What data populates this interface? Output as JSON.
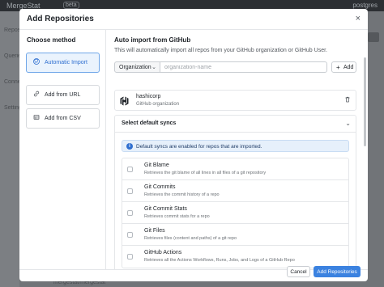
{
  "backdrop": {
    "logo": "MergeStat",
    "beta": "beta",
    "user": "postgres",
    "sidebar": [
      "Repos",
      "Queries",
      "Connect",
      "Settings"
    ],
    "bottom_text": "mergestat/mergestat"
  },
  "modal": {
    "title": "Add Repositories",
    "close": "×"
  },
  "methods": {
    "heading": "Choose method",
    "items": [
      {
        "label": "Automatic Import",
        "icon": "github-icon"
      },
      {
        "label": "Add from URL",
        "icon": "link-icon"
      },
      {
        "label": "Add from CSV",
        "icon": "table-icon"
      }
    ]
  },
  "auto_import": {
    "title": "Auto import from GitHub",
    "description": "This will automatically import all repos from your GitHub organization or GitHub User.",
    "select_value": "Organization",
    "input_placeholder": "organization-name",
    "add_label": "Add"
  },
  "org": {
    "name": "hashicorp",
    "type": "GitHub organization"
  },
  "syncs": {
    "title": "Select default syncs",
    "info": "Default syncs are enabled for repos that are imported.",
    "items": [
      {
        "name": "Git Blame",
        "desc": "Retrieves the git blame of all lines in all files of a git repository"
      },
      {
        "name": "Git Commits",
        "desc": "Retrieves the commit history of a repo"
      },
      {
        "name": "Git Commit Stats",
        "desc": "Retrieves commit stats for a repo"
      },
      {
        "name": "Git Files",
        "desc": "Retrieves files (content and paths) of a git repo"
      },
      {
        "name": "GitHub Actions",
        "desc": "Retrieves all the Actions Workflows, Runs, Jobs, and Logs of a GitHub Repo"
      }
    ]
  },
  "footer": {
    "cancel": "Cancel",
    "submit": "Add Repositories"
  },
  "colors": {
    "accent": "#3b82e0",
    "active_bg": "#eaf3fd"
  }
}
